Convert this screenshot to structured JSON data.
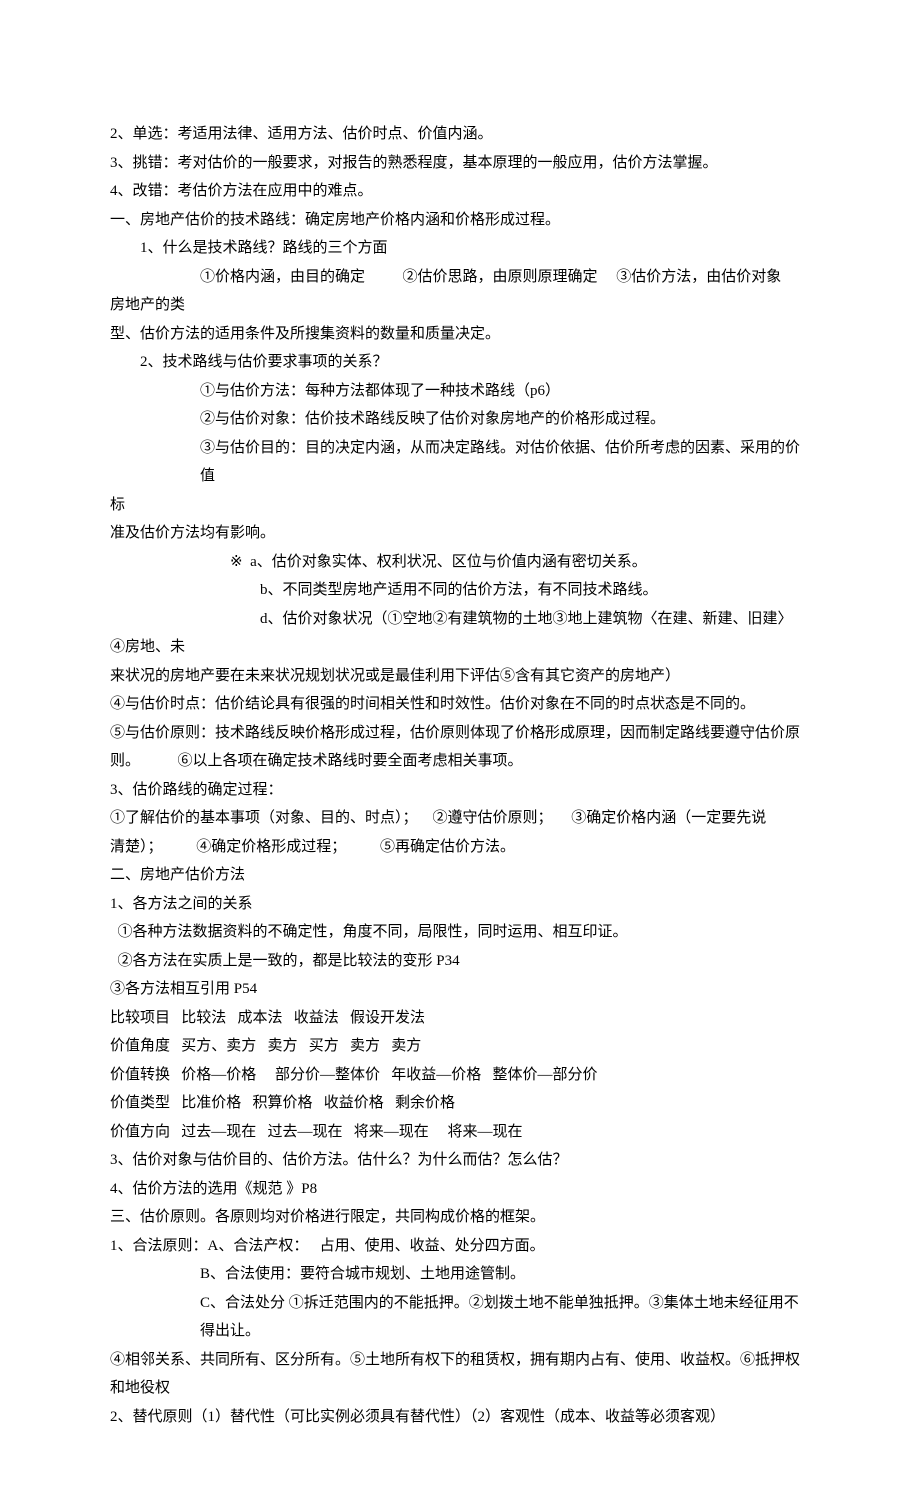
{
  "lines": [
    {
      "cls": "",
      "text": "2、单选：考适用法律、适用方法、估价时点、价值内涵。"
    },
    {
      "cls": "",
      "text": "3、挑错：考对估价的一般要求，对报告的熟悉程度，基本原理的一般应用，估价方法掌握。"
    },
    {
      "cls": "",
      "text": "4、改错：考估价方法在应用中的难点。"
    },
    {
      "cls": "",
      "text": "一、房地产估价的技术路线：确定房地产价格内涵和价格形成过程。"
    },
    {
      "cls": "indent1",
      "text": "1、什么是技术路线？路线的三个方面"
    },
    {
      "cls": "indent3",
      "text": "①价格内涵，由目的确定          ②估价思路，由原则原理确定     ③估价方法，由估价对象"
    },
    {
      "cls": "",
      "text": "房地产的类"
    },
    {
      "cls": "",
      "text": "型、估价方法的适用条件及所搜集资料的数量和质量决定。"
    },
    {
      "cls": "indent1",
      "text": "2、技术路线与估价要求事项的关系？"
    },
    {
      "cls": "indent3",
      "text": "①与估价方法：每种方法都体现了一种技术路线（p6）"
    },
    {
      "cls": "indent3",
      "text": "②与估价对象：估价技术路线反映了估价对象房地产的价格形成过程。"
    },
    {
      "cls": "indent3",
      "text": "③与估价目的：目的决定内涵，从而决定路线。对估价依据、估价所考虑的因素、采用的价值"
    },
    {
      "cls": "",
      "text": "标"
    },
    {
      "cls": "",
      "text": "准及估价方法均有影响。"
    },
    {
      "cls": "indent4",
      "text": "※  a、估价对象实体、权利状况、区位与价值内涵有密切关系。"
    },
    {
      "cls": "indent5",
      "text": "b、不同类型房地产适用不同的估价方法，有不同技术路线。"
    },
    {
      "cls": "indent5",
      "text": "d、估价对象状况（①空地②有建筑物的土地③地上建筑物〈在建、新建、旧建〉"
    },
    {
      "cls": "",
      "text": "④房地、未"
    },
    {
      "cls": "",
      "text": "来状况的房地产要在未来状况规划状况或是最佳利用下评估⑤含有其它资产的房地产）"
    },
    {
      "cls": "",
      "text": "④与估价时点：估价结论具有很强的时间相关性和时效性。估价对象在不同的时点状态是不同的。"
    },
    {
      "cls": "",
      "text": "⑤与估价原则：技术路线反映价格形成过程，估价原则体现了价格形成原理，因而制定路线要遵守估价原"
    },
    {
      "cls": "",
      "text": "则。          ⑥以上各项在确定技术路线时要全面考虑相关事项。"
    },
    {
      "cls": "",
      "text": "3、估价路线的确定过程："
    },
    {
      "cls": "",
      "text": "①了解估价的基本事项（对象、目的、时点）；    ②遵守估价原则；     ③确定价格内涵（一定要先说"
    },
    {
      "cls": "",
      "text": "清楚）；         ④确定价格形成过程；         ⑤再确定估价方法。"
    },
    {
      "cls": "",
      "text": "二、房地产估价方法"
    },
    {
      "cls": "",
      "text": "1、各方法之间的关系"
    },
    {
      "cls": "",
      "text": "  ①各种方法数据资料的不确定性，角度不同，局限性，同时运用、相互印证。"
    },
    {
      "cls": "",
      "text": "  ②各方法在实质上是一致的，都是比较法的变形 P34"
    },
    {
      "cls": "",
      "text": "③各方法相互引用 P54"
    },
    {
      "cls": "",
      "text": "比较项目   比较法   成本法   收益法   假设开发法"
    },
    {
      "cls": "",
      "text": "价值角度   买方、卖方   卖方   买方   卖方   卖方"
    },
    {
      "cls": "",
      "text": "价值转换   价格—价格     部分价—整体价   年收益—价格   整体价—部分价"
    },
    {
      "cls": "",
      "text": "价值类型   比准价格   积算价格   收益价格   剩余价格"
    },
    {
      "cls": "",
      "text": "价值方向   过去—现在   过去—现在   将来—现在     将来—现在"
    },
    {
      "cls": "",
      "text": "3、估价对象与估价目的、估价方法。估什么？为什么而估？怎么估？"
    },
    {
      "cls": "",
      "text": "4、估价方法的选用《规范 》P8"
    },
    {
      "cls": "",
      "text": "三、估价原则。各原则均对价格进行限定，共同构成价格的框架。"
    },
    {
      "cls": "",
      "text": "1、合法原则：A、合法产权：   占用、使用、收益、处分四方面。"
    },
    {
      "cls": "indent3",
      "text": "B、合法使用：要符合城市规划、土地用途管制。"
    },
    {
      "cls": "indent3",
      "text": "C、合法处分 ①拆迁范围内的不能抵押。②划拨土地不能单独抵押。③集体土地未经征用不得出让。"
    },
    {
      "cls": "",
      "text": "④相邻关系、共同所有、区分所有。⑤土地所有权下的租赁权，拥有期内占有、使用、收益权。⑥抵押权"
    },
    {
      "cls": "",
      "text": "和地役权"
    },
    {
      "cls": "",
      "text": "2、替代原则（1）替代性（可比实例必须具有替代性）（2）客观性（成本、收益等必须客观）"
    }
  ]
}
